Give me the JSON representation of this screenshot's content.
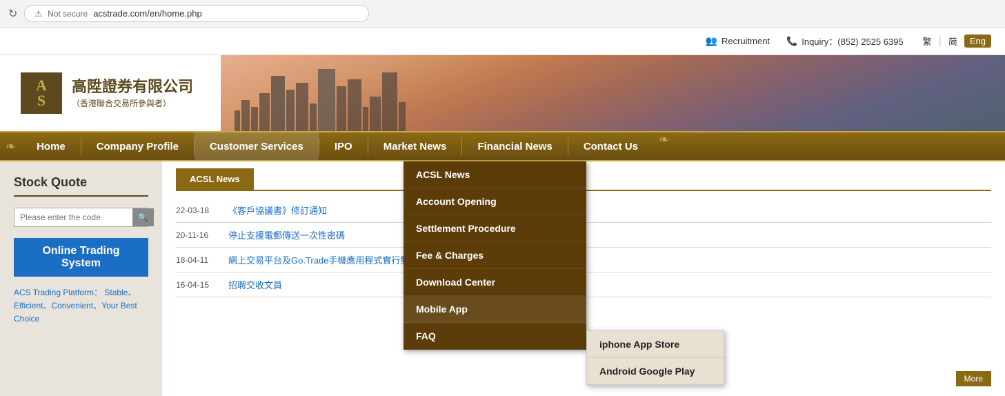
{
  "browser": {
    "url": "acstrade.com/en/home.php",
    "secure_label": "Not secure"
  },
  "top_bar": {
    "recruitment_label": "Recruitment",
    "inquiry_label": "Inquiry：(852) 2525 6395",
    "lang_trad": "繁",
    "lang_simp": "简",
    "lang_eng": "Eng"
  },
  "header": {
    "logo_letters": "A\nS",
    "company_name_zh": "高陞證券有限公司",
    "company_sub_zh": "（香港聯合交易所參與者）"
  },
  "nav": {
    "items": [
      {
        "label": "Home",
        "id": "home"
      },
      {
        "label": "Company Profile",
        "id": "company-profile"
      },
      {
        "label": "Customer Services",
        "id": "customer-services"
      },
      {
        "label": "IPO",
        "id": "ipo"
      },
      {
        "label": "Market News",
        "id": "market-news"
      },
      {
        "label": "Financial News",
        "id": "financial-news"
      },
      {
        "label": "Contact Us",
        "id": "contact-us"
      }
    ]
  },
  "dropdown": {
    "items": [
      {
        "label": "ACSL News",
        "id": "acsl-news"
      },
      {
        "label": "Account Opening",
        "id": "account-opening"
      },
      {
        "label": "Settlement Procedure",
        "id": "settlement-procedure"
      },
      {
        "label": "Fee & Charges",
        "id": "fee-charges"
      },
      {
        "label": "Download Center",
        "id": "download-center"
      },
      {
        "label": "Mobile App",
        "id": "mobile-app"
      },
      {
        "label": "FAQ",
        "id": "faq"
      }
    ],
    "sub_items": [
      {
        "label": "iphone App Store",
        "id": "iphone-app-store"
      },
      {
        "label": "Android Google Play",
        "id": "android-google-play"
      }
    ]
  },
  "sidebar": {
    "stock_quote_title": "Stock Quote",
    "search_placeholder": "Please enter the code",
    "online_trading_label": "Online Trading System",
    "platform_text": "ACS Trading Platform： Stable、Efficient、Convenient、Your Best Choice"
  },
  "news": {
    "tab_label": "ACSL News",
    "items": [
      {
        "date": "22-03-18",
        "text": "《客戶協議書》修訂通知"
      },
      {
        "date": "20-11-16",
        "text": "停止支援電郵傳送一次性密碼"
      },
      {
        "date": "18-04-11",
        "text": "網上交易平台及Go.Trade手機應用程式實行雙重認證"
      },
      {
        "date": "16-04-15",
        "text": "招聘交收文員"
      }
    ],
    "more_label": "More"
  }
}
